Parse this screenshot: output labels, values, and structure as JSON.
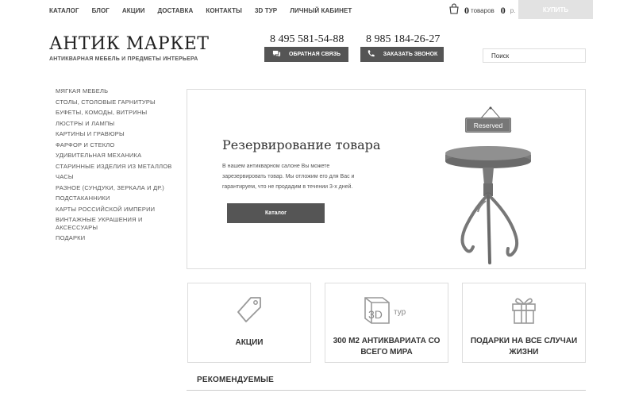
{
  "topnav": [
    "КАТАЛОГ",
    "БЛОГ",
    "АКЦИИ",
    "ДОСТАВКА",
    "КОНТАКТЫ",
    "3D ТУР",
    "ЛИЧНЫЙ КАБИНЕТ"
  ],
  "cart": {
    "icon": "shopping-bag-icon",
    "count": "0",
    "count_label": "товаров",
    "sum": "0",
    "currency": "р.",
    "buy_label": "КУПИТЬ"
  },
  "header": {
    "logo_title": "АНТИК МАРКЕТ",
    "logo_subtitle": "АНТИКВАРНАЯ МЕБЕЛЬ И ПРЕДМЕТЫ ИНТЕРЬЕРА",
    "phone1": "8 495 581-54-88",
    "phone2": "8 985 184-26-27",
    "feedback_label": "ОБРАТНАЯ СВЯЗЬ",
    "callback_label": "ЗАКАЗАТЬ ЗВОНОК",
    "search_placeholder": "Поиск"
  },
  "sidebar": [
    "МЯГКАЯ МЕБЕЛЬ",
    "СТОЛЫ, СТОЛОВЫЕ ГАРНИТУРЫ",
    "БУФЕТЫ, КОМОДЫ, ВИТРИНЫ",
    "ЛЮСТРЫ И ЛАМПЫ",
    "КАРТИНЫ И ГРАВЮРЫ",
    "ФАРФОР И СТЕКЛО",
    "УДИВИТЕЛЬНАЯ МЕХАНИКА",
    "СТАРИННЫЕ ИЗДЕЛИЯ ИЗ МЕТАЛЛОВ",
    "ЧАСЫ",
    "РАЗНОЕ (СУНДУКИ, ЗЕРКАЛА И ДР.)",
    "ПОДСТАКАННИКИ",
    "КАРТЫ РОССИЙСКОЙ ИМПЕРИИ",
    "ВИНТАЖНЫЕ УКРАШЕНИЯ И АКСЕССУАРЫ",
    "ПОДАРКИ"
  ],
  "hero": {
    "title": "Резервирование товара",
    "text": "В нашем антикварном салоне Вы можете зарезервировать товар. Мы отложим его для Вас и гарантируем, что не продадим в течении 3-х дней.",
    "button": "Каталог",
    "sign_text": "Reserved"
  },
  "cards": [
    {
      "label": "АКЦИИ",
      "icon": "price-tag-icon"
    },
    {
      "label": "300 М2 АНТИКВАРИАТА СО ВСЕГО МИРА",
      "icon": "3d-tour-icon",
      "icon_text": "3D",
      "icon_sub": "тур"
    },
    {
      "label": "ПОДАРКИ НА ВСЕ СЛУЧАИ ЖИЗНИ",
      "icon": "gift-icon"
    }
  ],
  "recommended": "РЕКОМЕНДУЕМЫЕ"
}
